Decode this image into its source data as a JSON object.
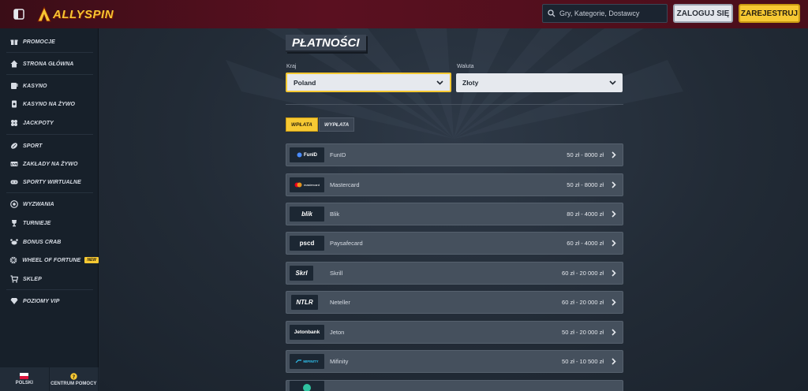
{
  "header": {
    "logo_text": "ALLYSPIN",
    "search_placeholder": "Gry, Kategorie, Dostawcy",
    "login_label": "ZALOGUJ SIĘ",
    "register_label": "ZAREJESTRUJ"
  },
  "sidebar": {
    "items": [
      {
        "label": "PROMOCJE",
        "icon": "gift-icon"
      },
      {
        "label": "STRONA GŁÓWNA",
        "icon": "home-icon"
      },
      {
        "label": "KASYNO",
        "icon": "slot-icon"
      },
      {
        "label": "KASYNO NA ŻYWO",
        "icon": "cards-icon"
      },
      {
        "label": "JACKPOTY",
        "icon": "clover-icon"
      },
      {
        "label": "SPORT",
        "icon": "ball-icon"
      },
      {
        "label": "ZAKŁADY NA ŻYWO",
        "icon": "live-icon"
      },
      {
        "label": "SPORTY WIRTUALNE",
        "icon": "gamepad-icon"
      },
      {
        "label": "WYZWANIA",
        "icon": "target-icon"
      },
      {
        "label": "TURNIEJE",
        "icon": "trophy-icon"
      },
      {
        "label": "BONUS CRAB",
        "icon": "crab-icon"
      },
      {
        "label": "WHEEL OF FORTUNE",
        "icon": "wheel-icon",
        "badge": "NEW"
      },
      {
        "label": "SKLEP",
        "icon": "cart-icon"
      },
      {
        "label": "POZIOMY VIP",
        "icon": "diamond-icon"
      }
    ],
    "language_label": "POLSKI",
    "help_label": "CENTRUM POMOCY"
  },
  "main": {
    "title": "PŁATNOŚCI",
    "country_label": "Kraj",
    "country_value": "Poland",
    "currency_label": "Waluta",
    "currency_value": "Złoty",
    "tabs": [
      {
        "label": "WPŁATA",
        "active": true
      },
      {
        "label": "WYPŁATA",
        "active": false
      }
    ],
    "methods": [
      {
        "logo": "FunID",
        "name": "FunID",
        "range": "50 zł - 8000 zł"
      },
      {
        "logo": "mastercard",
        "name": "Mastercard",
        "range": "50 zł - 8000 zł"
      },
      {
        "logo": "blik",
        "name": "Blik",
        "range": "80 zł - 4000 zł"
      },
      {
        "logo": "pscd",
        "name": "Paysafecard",
        "range": "60 zł - 4000 zł"
      },
      {
        "logo": "Skrl",
        "name": "Skrill",
        "range": "60 zł - 20 000 zł"
      },
      {
        "logo": "NTLR",
        "name": "Neteller",
        "range": "60 zł - 20 000 zł"
      },
      {
        "logo": "Jetonbank",
        "name": "Jeton",
        "range": "50 zł - 20 000 zł"
      },
      {
        "logo": "MIFINITY",
        "name": "Mifinity",
        "range": "50 zł - 10 500 zł"
      }
    ]
  },
  "colors": {
    "accent": "#f7c933",
    "header_bg": "#4a0e1a",
    "sidebar_bg": "#17202a",
    "row_bg": "#45505d"
  }
}
